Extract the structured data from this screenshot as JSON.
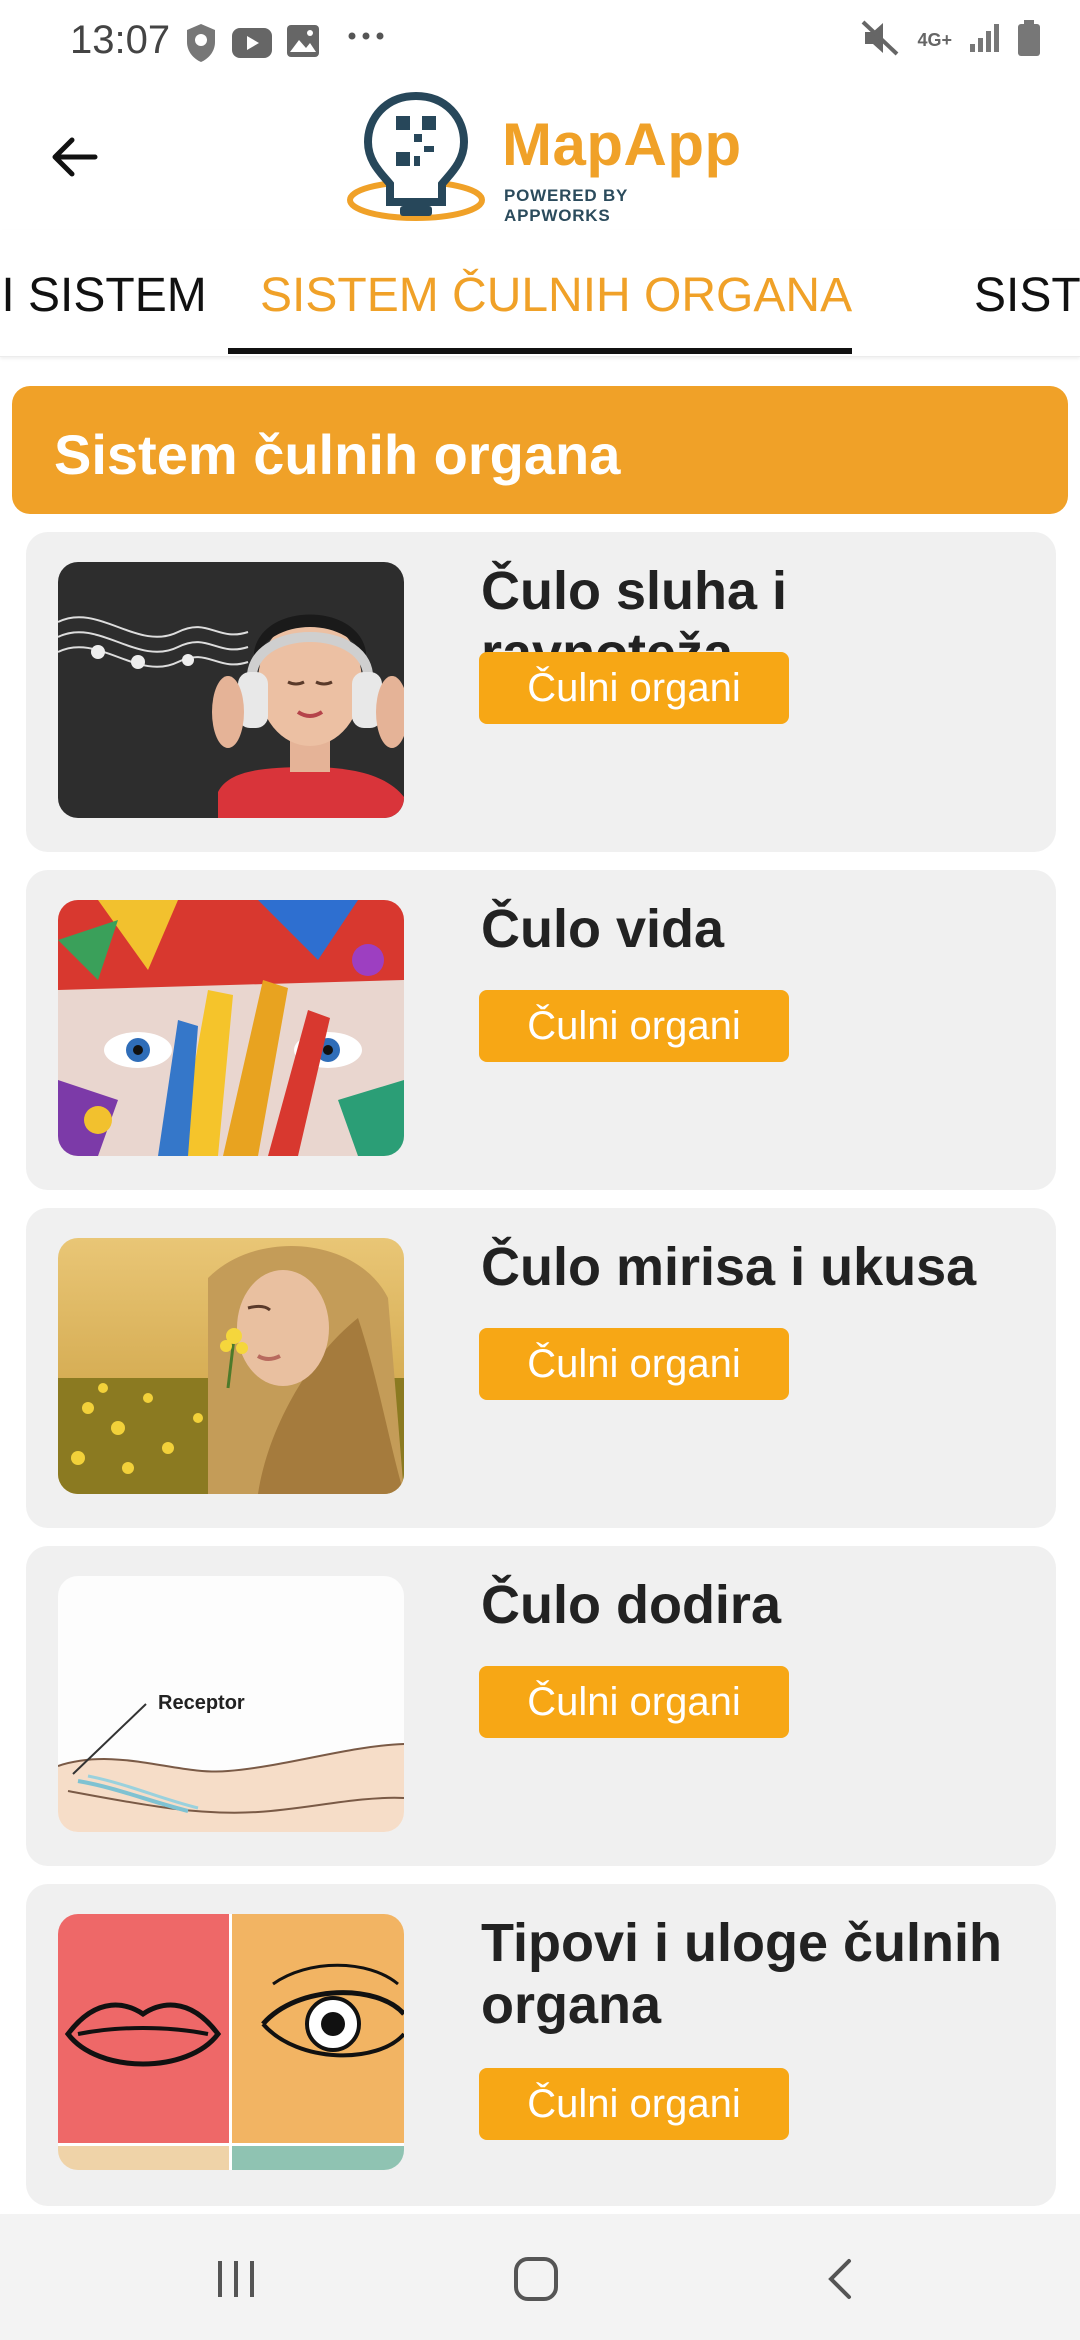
{
  "status_bar": {
    "time": "13:07",
    "network_label": "4G+"
  },
  "header": {
    "logo_title": "MapApp",
    "logo_subtitle": "POWERED BY APPWORKS"
  },
  "tabs": [
    {
      "label": "II SISTEM"
    },
    {
      "label": "SISTEM ČULNIH ORGANA",
      "active": true
    },
    {
      "label": "SISTE"
    }
  ],
  "section": {
    "title": "Sistem čulnih organa"
  },
  "cards": [
    {
      "title": "Čulo sluha i ravnoteža",
      "button": "Čulni organi",
      "image": "headphones-photo"
    },
    {
      "title": "Čulo vida",
      "button": "Čulni organi",
      "image": "painted-face-photo"
    },
    {
      "title": "Čulo mirisa i ukusa",
      "button": "Čulni organi",
      "image": "flower-field-photo"
    },
    {
      "title": "Čulo dodira",
      "button": "Čulni organi",
      "image": "receptor-diagram",
      "image_label": "Receptor"
    },
    {
      "title": "Tipovi i uloge čulnih organa",
      "button": "Čulni organi",
      "image": "lips-eye-illustration"
    }
  ],
  "colors": {
    "accent": "#f0a128",
    "button": "#f7a715",
    "card_bg": "#f0f0f0"
  }
}
